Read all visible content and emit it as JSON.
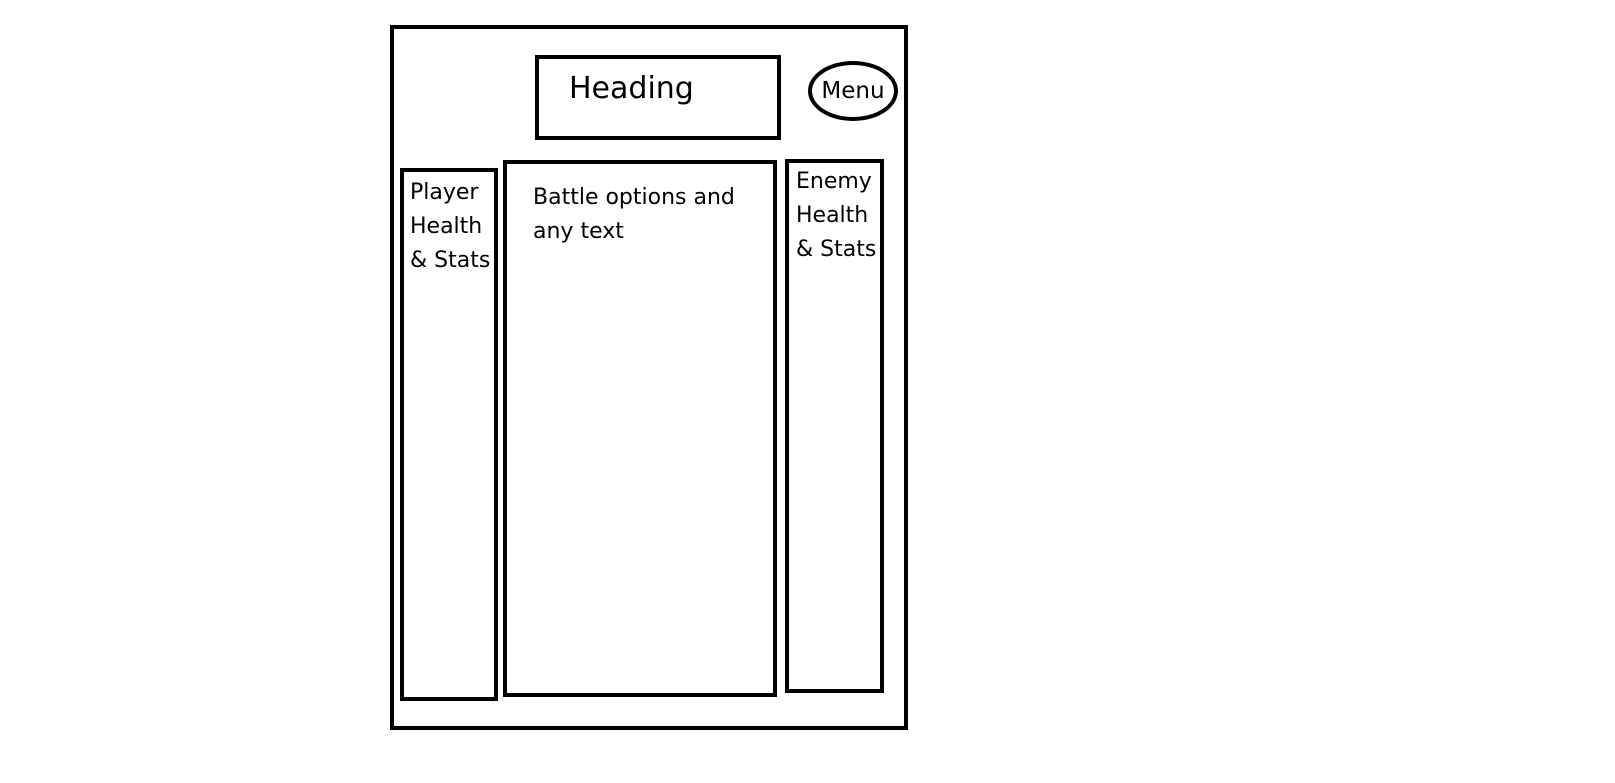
{
  "heading": {
    "label": "Heading"
  },
  "menu": {
    "label": "Menu"
  },
  "player_panel": {
    "label": "Player\nHealth\n& Stats"
  },
  "battle_panel": {
    "label": "Battle options and any text"
  },
  "enemy_panel": {
    "label": "Enemy\nHealth\n& Stats"
  }
}
